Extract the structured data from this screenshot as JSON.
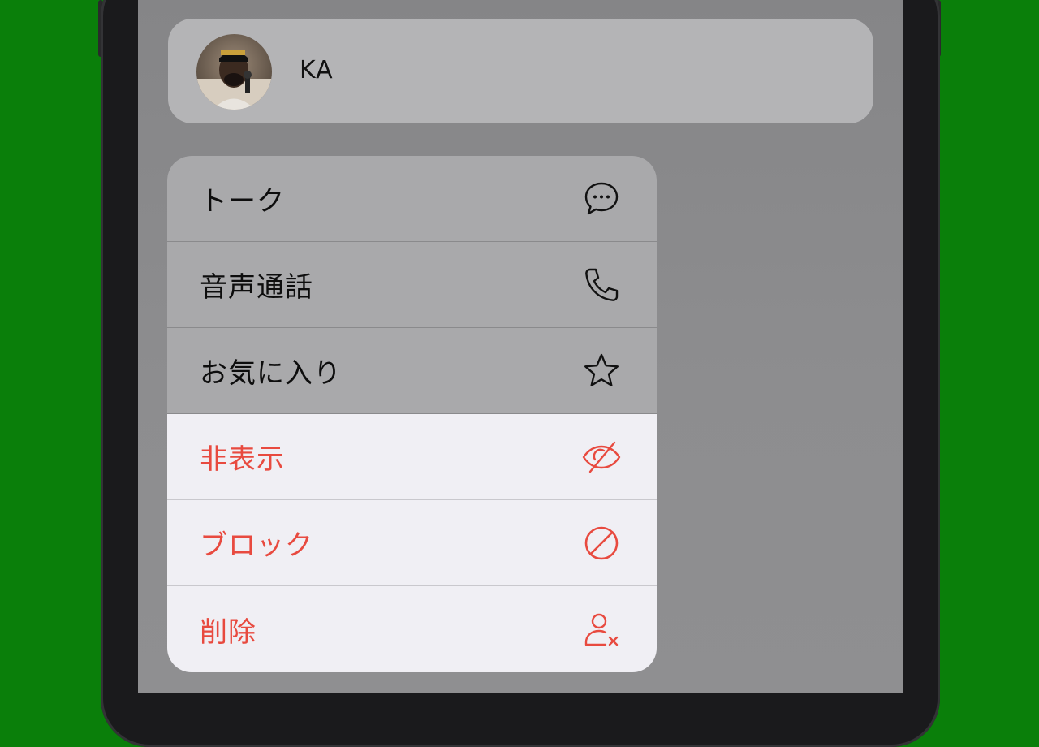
{
  "contact": {
    "name": "KA"
  },
  "menu": {
    "items": [
      {
        "label": "トーク",
        "icon": "chat-bubble-icon",
        "style": "default"
      },
      {
        "label": "音声通話",
        "icon": "phone-icon",
        "style": "default"
      },
      {
        "label": "お気に入り",
        "icon": "star-icon",
        "style": "default"
      },
      {
        "label": "非表示",
        "icon": "eye-slash-icon",
        "style": "destructive"
      },
      {
        "label": "ブロック",
        "icon": "block-icon",
        "style": "destructive"
      },
      {
        "label": "削除",
        "icon": "person-remove-icon",
        "style": "destructive"
      }
    ]
  },
  "colors": {
    "background_green": "#0a7f0a",
    "destructive_red": "#e84a3f"
  }
}
